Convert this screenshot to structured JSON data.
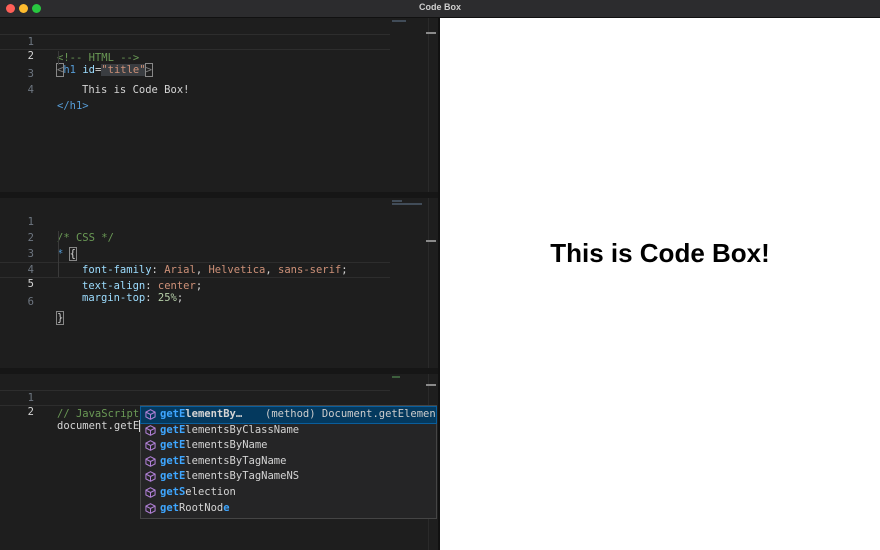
{
  "window": {
    "title": "Code Box"
  },
  "html_pane": {
    "line_numbers": [
      "1",
      "2",
      "3",
      "4"
    ],
    "comment": "<!-- HTML -->",
    "open_tag_lt": "<",
    "tag_name": "h1",
    "attr_name": "id",
    "attr_eq": "=",
    "attr_value": "\"title\"",
    "open_tag_gt": ">",
    "text": "This is Code Box!",
    "close_tag": "</h1>"
  },
  "css_pane": {
    "line_numbers": [
      "1",
      "2",
      "3",
      "4",
      "5",
      "6"
    ],
    "comment": "/* CSS */",
    "selector": "*",
    "brace_open": "{",
    "rules": [
      {
        "prop": "font-family",
        "vals": [
          "Arial",
          "Helvetica",
          "sans-serif"
        ]
      },
      {
        "prop": "text-align",
        "vals": [
          "center"
        ]
      },
      {
        "prop": "margin-top",
        "vals": [
          "25%"
        ]
      }
    ],
    "brace_close": "}"
  },
  "js_pane": {
    "line_numbers": [
      "1",
      "2"
    ],
    "comment": "// JavaScript",
    "code": "document.getE"
  },
  "suggestions": {
    "items": [
      {
        "match": "getE",
        "rest": "lementBy…",
        "detail": "(method) Document.getElementBy"
      },
      {
        "match": "getE",
        "rest": "lementsByClassName"
      },
      {
        "match": "getE",
        "rest": "lementsByName"
      },
      {
        "match": "getE",
        "rest": "lementsByTagName"
      },
      {
        "match": "getE",
        "rest": "lementsByTagNameNS"
      },
      {
        "pre": "get",
        "match2": "S",
        "rest2": "election"
      },
      {
        "pre": "get",
        "mid": "RootNod",
        "match3": "e"
      }
    ],
    "icon": "cube-icon",
    "accent": "#3ea6ff"
  },
  "preview": {
    "heading": "This is Code Box!"
  }
}
